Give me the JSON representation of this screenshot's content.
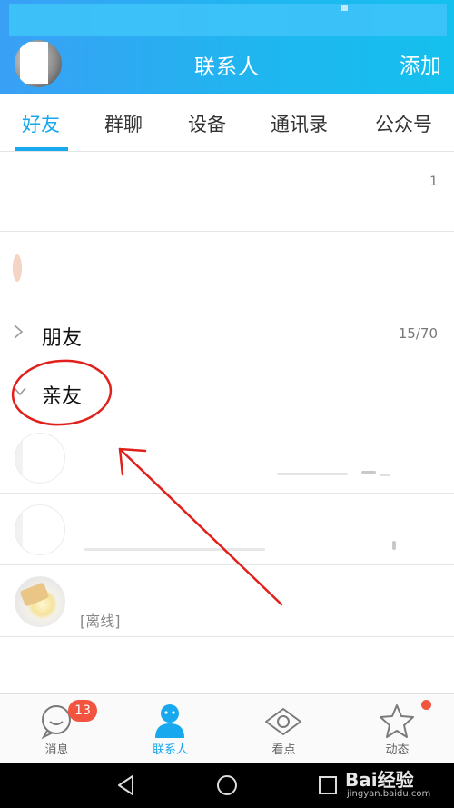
{
  "header": {
    "title": "联系人",
    "add_label": "添加",
    "accent": "#17a8ee"
  },
  "tabs": [
    {
      "label": "好友",
      "active": true
    },
    {
      "label": "群聊",
      "active": false
    },
    {
      "label": "设备",
      "active": false
    },
    {
      "label": "通讯录",
      "active": false
    },
    {
      "label": "公众号",
      "active": false
    }
  ],
  "top_rows": [
    {
      "count": "1"
    },
    {
      "count": ""
    }
  ],
  "groups": [
    {
      "name": "朋友",
      "count": "15/70",
      "expanded": false,
      "icon": "chevron-right-icon"
    },
    {
      "name": "亲友",
      "count": "",
      "expanded": true,
      "icon": "chevron-down-icon"
    }
  ],
  "friends": [
    {
      "status": ""
    },
    {
      "status": ""
    },
    {
      "status": "[离线]"
    }
  ],
  "bottom_nav": [
    {
      "label": "消息",
      "icon": "chat-bubble-icon",
      "badge": "13",
      "active": false
    },
    {
      "label": "联系人",
      "icon": "contacts-person-icon",
      "badge": "",
      "active": true
    },
    {
      "label": "看点",
      "icon": "eye-icon",
      "badge": "",
      "active": false
    },
    {
      "label": "动态",
      "icon": "star-icon",
      "badge": "",
      "red_dot": true,
      "active": false
    }
  ],
  "watermark": {
    "brand": "Bai经验",
    "url": "jingyan.baidu.com"
  },
  "colors": {
    "badge": "#f2543f",
    "annotation": "#e0201b"
  }
}
